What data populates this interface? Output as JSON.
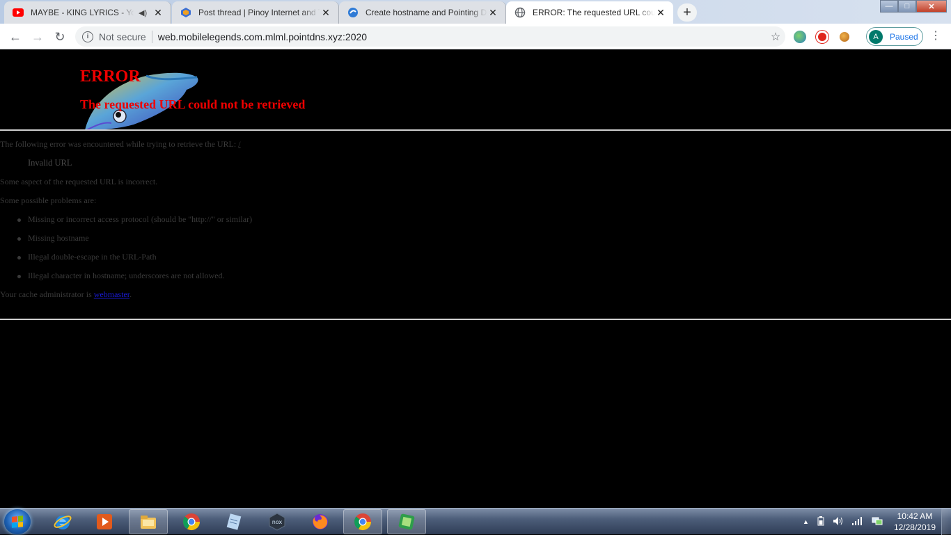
{
  "browser": {
    "tabs": [
      {
        "title": "MAYBE - KING LYRICS - YouTube",
        "favicon": "youtube-icon",
        "audio": true,
        "active": false
      },
      {
        "title": "Post thread | Pinoy Internet and Technology Forums",
        "favicon": "forum-icon",
        "audio": false,
        "active": false
      },
      {
        "title": "Create hostname and Pointing DNS",
        "favicon": "noip-icon",
        "audio": false,
        "active": false
      },
      {
        "title": "ERROR: The requested URL could not be retrieved",
        "favicon": "globe-icon",
        "audio": false,
        "active": true
      }
    ],
    "close_glyph": "✕",
    "new_tab_glyph": "+",
    "window_controls": {
      "minimize": "—",
      "maximize": "□",
      "close": "✕"
    },
    "toolbar": {
      "back_glyph": "←",
      "forward_glyph": "→",
      "reload_glyph": "↻",
      "security_label": "Not secure",
      "info_glyph": "i",
      "url": "web.mobilelegends.com.mlml.pointdns.xyz:2020",
      "star_glyph": "☆",
      "profile_initial": "A",
      "profile_status": "Paused",
      "menu_glyph": "⋮"
    }
  },
  "page": {
    "heading": "ERROR",
    "subheading": "The requested URL could not be retrieved",
    "intro_prefix": "The following error was encountered while trying to retrieve the URL:",
    "intro_url": "/",
    "error_name": "Invalid URL",
    "description": "Some aspect of the requested URL is incorrect.",
    "problems_label": "Some possible problems are:",
    "problems": [
      "Missing or incorrect access protocol (should be \"http://\" or similar)",
      "Missing hostname",
      "Illegal double-escape in the URL-Path",
      "Illegal character in hostname; underscores are not allowed."
    ],
    "admin_prefix": "Your cache administrator is",
    "admin_link": "webmaster",
    "admin_suffix": ".",
    "colors": {
      "heading": "#e00000",
      "background": "#000000",
      "link": "#1a1ad8"
    }
  },
  "taskbar": {
    "items": [
      {
        "name": "internet-explorer-icon"
      },
      {
        "name": "media-player-icon"
      },
      {
        "name": "file-explorer-icon"
      },
      {
        "name": "chrome-icon"
      },
      {
        "name": "notepad-icon"
      },
      {
        "name": "nox-icon"
      },
      {
        "name": "firefox-icon"
      },
      {
        "name": "chrome-icon"
      },
      {
        "name": "app-icon"
      }
    ],
    "tray": {
      "expand_glyph": "▲",
      "time": "10:42 AM",
      "date": "12/28/2019"
    }
  }
}
